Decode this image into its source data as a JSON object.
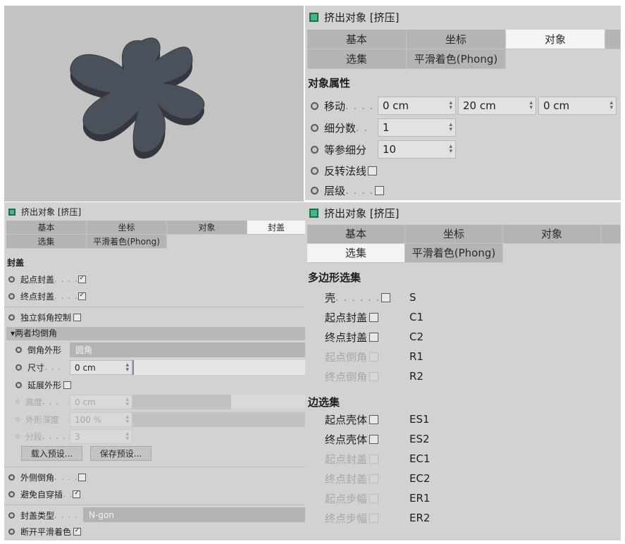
{
  "viewport": {
    "label": "3d-viewport"
  },
  "panel_top_right": {
    "title": "挤出对象 [挤压]",
    "tabs_row1": [
      "基本",
      "坐标",
      "对象"
    ],
    "tabs_row2": [
      "选集",
      "平滑着色(Phong)"
    ],
    "selected_tab": "对象",
    "section": "对象属性",
    "move": {
      "label": "移动",
      "dots": " . . . . ",
      "x": "0 cm",
      "y": "20 cm",
      "z": "0 cm"
    },
    "subdiv": {
      "label": "细分数",
      "dots": " . . ",
      "value": "1"
    },
    "isoparm": {
      "label": "等参细分",
      "value": "10"
    },
    "flip_normals": {
      "label": "反转法线",
      "checked": false
    },
    "hierarchy": {
      "label": "层级",
      "dots": " . . . . ",
      "checked": false
    }
  },
  "panel_bottom_left": {
    "title": "挤出对象 [挤压]",
    "tabs_row1": [
      "基本",
      "坐标",
      "对象",
      "封盖"
    ],
    "tabs_row2": [
      "选集",
      "平滑着色(Phong)"
    ],
    "selected_tab": "封盖",
    "section": "封盖",
    "start_cap": {
      "label": "起点封盖",
      "dots": " . . . . ",
      "checked": true
    },
    "end_cap": {
      "label": "终点封盖",
      "dots": " . . . . ",
      "checked": true
    },
    "independent_fillet": {
      "label": "独立斜角控制",
      "checked": false
    },
    "group": "▾两者均倒角",
    "fillet_shape": {
      "label": "倒角外形",
      "value": "圆角"
    },
    "size": {
      "label": "尺寸",
      "dots": " . . . ",
      "value": "0 cm"
    },
    "extend_shape": {
      "label": "延展外形",
      "checked": false
    },
    "height": {
      "label": "高度",
      "dots": " . . . ",
      "value": "0 cm"
    },
    "shape_depth": {
      "label": "外形深度",
      "value": "100 %"
    },
    "segments": {
      "label": "分段",
      "dots": " . . . . ",
      "value": "3"
    },
    "load_preset": "载入预设...",
    "save_preset": "保存预设...",
    "outer_fillet": {
      "label": "外侧倒角",
      "dots": " . . . . ",
      "checked": false
    },
    "avoid_self_intersection": {
      "label": "避免自穿插",
      "dots": " . . ",
      "checked": true
    },
    "cap_type": {
      "label": "封盖类型",
      "dots": " . . . . ",
      "value": "N-gon"
    },
    "break_phong": {
      "label": "断开平滑着色",
      "checked": true
    }
  },
  "panel_bottom_right": {
    "title": "挤出对象 [挤压]",
    "tabs_row1": [
      "基本",
      "坐标",
      "对象"
    ],
    "tabs_row2": [
      "选集",
      "平滑着色(Phong)"
    ],
    "selected_tab": "选集",
    "section_poly": "多边形选集",
    "poly": [
      {
        "label": "壳",
        "dots": " . . . . . . ",
        "tag": "S",
        "enabled": true
      },
      {
        "label": "起点封盖",
        "tag": "C1",
        "enabled": true
      },
      {
        "label": "终点封盖",
        "tag": "C2",
        "enabled": true
      },
      {
        "label": "起点倒角",
        "tag": "R1",
        "enabled": false
      },
      {
        "label": "终点倒角",
        "tag": "R2",
        "enabled": false
      }
    ],
    "section_edge": "边选集",
    "edge": [
      {
        "label": "起点壳体",
        "tag": "ES1",
        "enabled": true
      },
      {
        "label": "终点壳体",
        "tag": "ES2",
        "enabled": true
      },
      {
        "label": "起点封盖",
        "tag": "EC1",
        "enabled": false
      },
      {
        "label": "终点封盖",
        "tag": "EC2",
        "enabled": false
      },
      {
        "label": "起点步幅",
        "tag": "ER1",
        "enabled": false
      },
      {
        "label": "终点步幅",
        "tag": "ER2",
        "enabled": false
      }
    ]
  }
}
